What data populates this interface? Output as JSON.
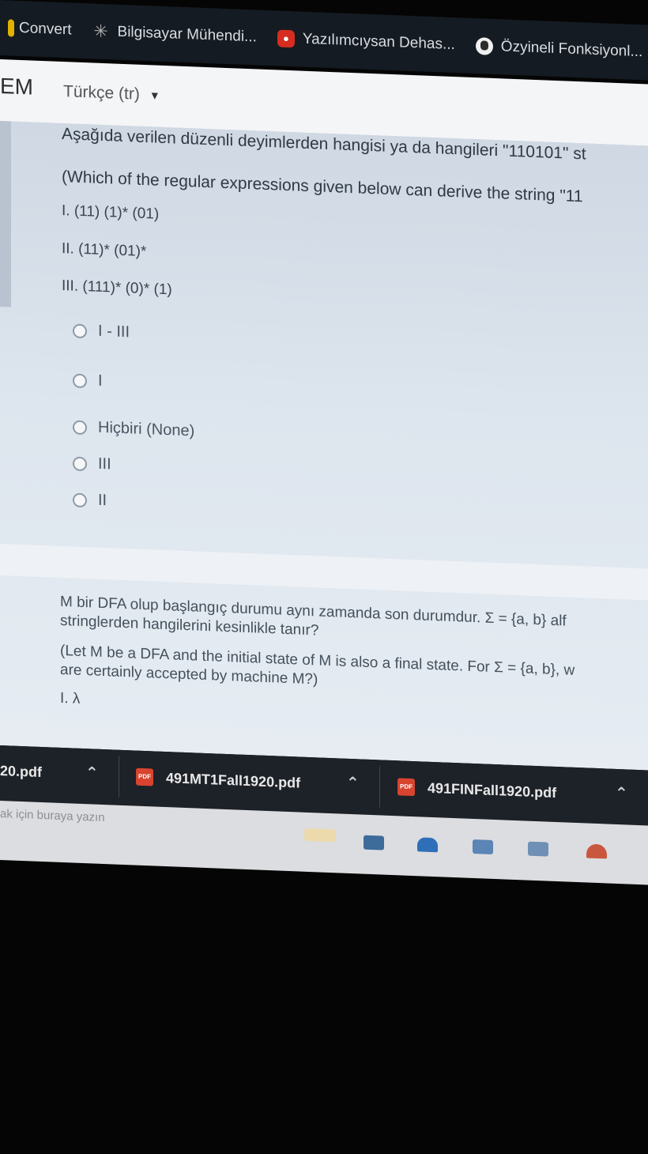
{
  "bookmarks": [
    {
      "label": "Convert",
      "icon": "convert-icon"
    },
    {
      "label": "Bilgisayar Mühendi...",
      "icon": "sparkle-icon"
    },
    {
      "label": "Yazılımcıysan Dehas...",
      "icon": "red-app-icon"
    },
    {
      "label": "Özyineli Fonksiyonl...",
      "icon": "globe-icon"
    }
  ],
  "header": {
    "brand": "EM",
    "language": "Türkçe (tr)"
  },
  "question1": {
    "text_tr": "Aşağıda verilen düzenli deyimlerden hangisi ya da hangileri \"110101\" st",
    "text_en": "(Which of the regular expressions given below can derive the string \"11",
    "expressions": [
      "I.  (11) (1)* (01)",
      "II.  (11)* (01)*",
      "III. (111)* (0)* (1)"
    ],
    "options": [
      "I - III",
      "I",
      "Hiçbiri (None)",
      "III",
      "II"
    ]
  },
  "question2": {
    "lines": [
      "M bir DFA olup başlangıç durumu aynı zamanda son durumdur. Σ = {a, b} alf",
      "stringlerden hangilerini kesinlikle tanır?",
      "(Let M be a DFA and the initial state of M is also a final state. For Σ = {a, b}, w",
      "are certainly accepted by machine M?)",
      "I.  λ"
    ]
  },
  "downloads": {
    "items": [
      "20.pdf",
      "491MT1Fall1920.pdf",
      "491FINFall1920.pdf"
    ],
    "pdf_badge": "PDF"
  },
  "taskbar": {
    "search_hint": "ak için buraya yazın"
  }
}
